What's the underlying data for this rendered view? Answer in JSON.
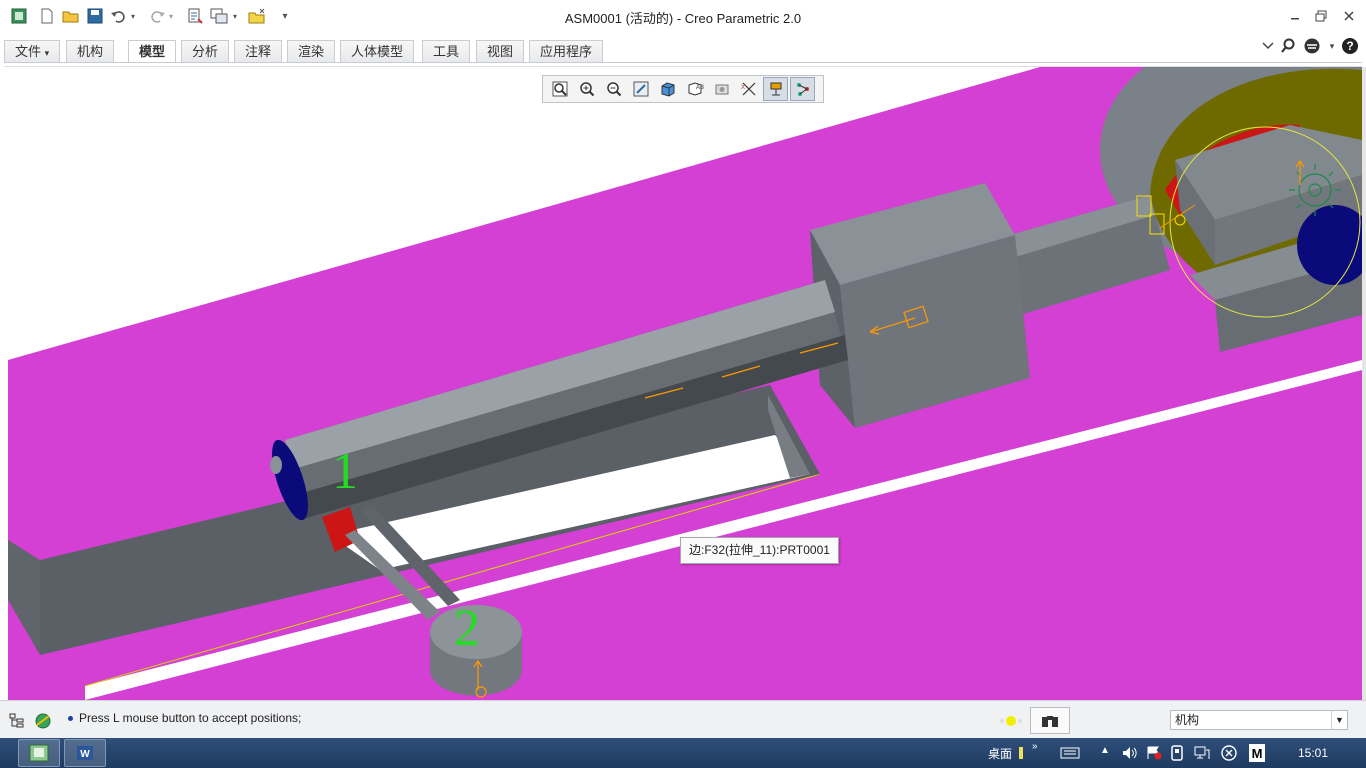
{
  "window": {
    "title": "ASM0001 (活动的) - Creo Parametric 2.0",
    "minimize_icon": "minimize-icon",
    "restore_icon": "restore-icon",
    "close_icon": "close-icon"
  },
  "quick_access": [
    "app-icon",
    "new-icon",
    "open-icon",
    "save-icon",
    "undo-icon",
    "redo-icon",
    "regenerate-icon",
    "windows-icon",
    "close-window-icon",
    "customize-icon"
  ],
  "ribbon": {
    "tabs": [
      {
        "label": "文件"
      },
      {
        "label": "机构"
      },
      {
        "label": "模型"
      },
      {
        "label": "分析"
      },
      {
        "label": "注释"
      },
      {
        "label": "渲染"
      },
      {
        "label": "人体模型"
      },
      {
        "label": "工具"
      },
      {
        "label": "视图"
      },
      {
        "label": "应用程序"
      }
    ],
    "active_tab": "模型",
    "file_tab_dropdown": "▾"
  },
  "graphics_toolbar": [
    "refit-icon",
    "zoom-in-icon",
    "zoom-out-icon",
    "repaint-icon",
    "display-style-icon",
    "saved-orientations-icon",
    "view-manager-icon",
    "datum-display-icon",
    "spin-center-icon",
    "annotation-display-icon"
  ],
  "viewport": {
    "labels": [
      {
        "text": "1"
      },
      {
        "text": "2"
      }
    ],
    "colors": {
      "plane": "#d43fd4",
      "body": "#7c8389",
      "body_dark": "#575d63",
      "accent_red": "#cc1515",
      "accent_blue": "#0a0a7a",
      "olive": "#6f6a00",
      "label_green": "#22dd22",
      "orange": "#ff9900"
    }
  },
  "tooltip": {
    "text": "边:F32(拉伸_11):PRT0001"
  },
  "status": {
    "message": "Press L mouse button to accept positions;",
    "filter_value": "机构"
  },
  "taskbar": {
    "desktop_label": "桌面",
    "time": "15:01",
    "chevron": "»"
  }
}
